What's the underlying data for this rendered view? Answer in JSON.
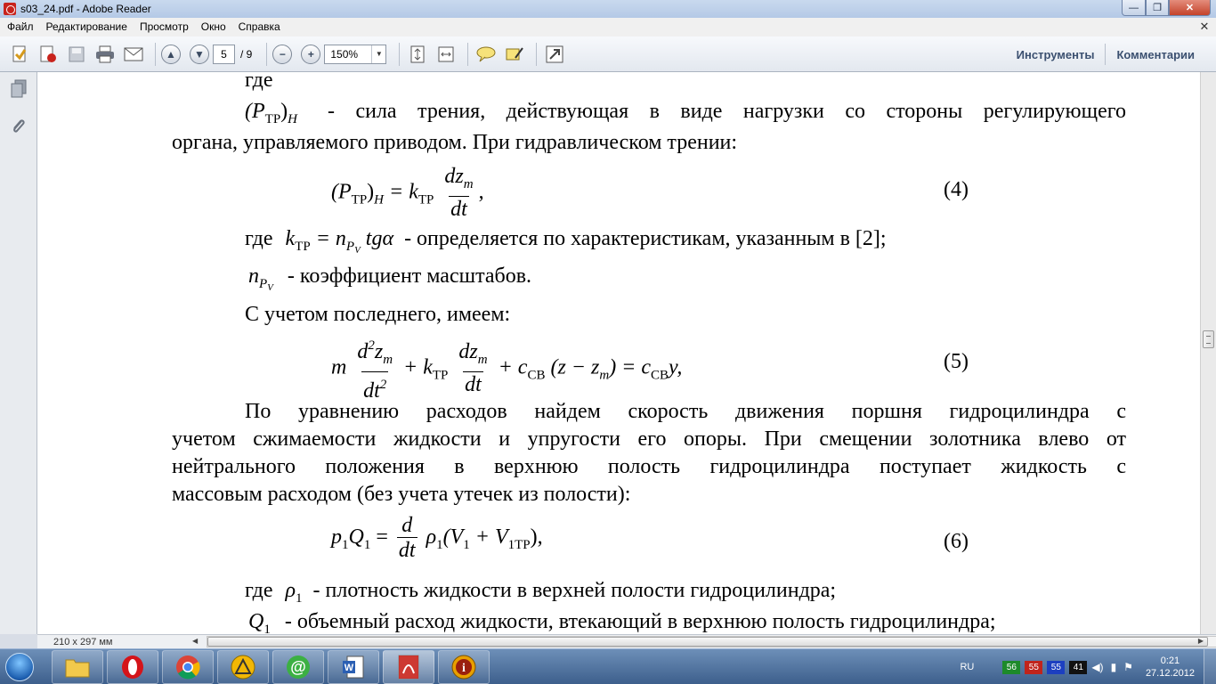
{
  "window": {
    "title": "s03_24.pdf - Adobe Reader",
    "minimize_glyph": "—",
    "maximize_glyph": "❐",
    "close_glyph": "✕"
  },
  "menu": {
    "items": [
      "Файл",
      "Редактирование",
      "Просмотр",
      "Окно",
      "Справка"
    ],
    "close_glyph": "✕"
  },
  "toolbar": {
    "current_page": "5",
    "total_pages": "/ 9",
    "zoom": "150%",
    "tools_label": "Инструменты",
    "comments_label": "Комментарии",
    "prev_glyph": "▲",
    "next_glyph": "▼",
    "zoom_out_glyph": "−",
    "zoom_in_glyph": "+",
    "dropdown_glyph": "▼"
  },
  "status": {
    "page_size": "210 x 297 мм"
  },
  "document": {
    "line01": "где",
    "l02_lhs_base": "(P",
    "l02_lhs_sub": "ТР",
    "l02_lhs_close": ")",
    "l02_lhs_h": "H",
    "l02_text": "- сила трения, действующая в виде нагрузки со стороны регулирующего",
    "line03": "органа, управляемого приводом. При гидравлическом трении:",
    "eq4_lhs": "(P",
    "eq4_lhs_sub": "ТР",
    "eq4_lhs_close": ")",
    "eq4_lhs_h": "H",
    "eq4_eq": "= k",
    "eq4_k_sub": "ТР",
    "eq4_num": "dz",
    "eq4_num_sub": "m",
    "eq4_den": "dt",
    "eq4_tail": ",",
    "eq4_number": "(4)",
    "l05_where": "где",
    "l05_k": "k",
    "l05_k_sub": "ТР",
    "l05_eq": "= n",
    "l05_n_sub": "P",
    "l05_n_subsub": "V",
    "l05_tg": "tgα",
    "l05_text": "- определяется по характеристикам, указанным в [2];",
    "l06_n": "n",
    "l06_n_sub": "P",
    "l06_n_subsub": "V",
    "l06_text": "- коэффициент масштабов.",
    "line07": "С учетом последнего, имеем:",
    "eq5_m": "m",
    "eq5_num1": "d",
    "eq5_num1_sup": "2",
    "eq5_num1_z": "z",
    "eq5_num1_sub": "m",
    "eq5_den1": "dt",
    "eq5_den1_sup": "2",
    "eq5_plus_k": "+ k",
    "eq5_k_sub": "ТР",
    "eq5_num2": "dz",
    "eq5_num2_sub": "m",
    "eq5_den2": "dt",
    "eq5_plus_c": "+ c",
    "eq5_c_sub": "СВ",
    "eq5_paren": "(z − z",
    "eq5_paren_sub": "m",
    "eq5_paren_close": ") = c",
    "eq5_c2_sub": "СВ",
    "eq5_tail": "y,",
    "eq5_number": "(5)",
    "para1_line1": "По уравнению расходов найдем скорость движения поршня гидроцилиндра с",
    "para1_line2": "учетом сжимаемости жидкости и упругости его опоры. При смещении золотника влево от",
    "para1_line3": "нейтрального положения в верхнюю полость гидроцилиндра поступает жидкость с",
    "para1_line4": "массовым расходом (без учета утечек из полости):",
    "eq6_lhs": "p",
    "eq6_p_sub": "1",
    "eq6_q": "Q",
    "eq6_q_sub": "1",
    "eq6_eq": "=",
    "eq6_num": "d",
    "eq6_den": "dt",
    "eq6_rho": "ρ",
    "eq6_rho_sub": "1",
    "eq6_paren": "(V",
    "eq6_v_sub": "1",
    "eq6_plus": "+ V",
    "eq6_v2_sub": "1ТР",
    "eq6_tail": "),",
    "eq6_number": "(6)",
    "l12_where": "где",
    "l12_rho": "ρ",
    "l12_rho_sub": "1",
    "l12_text": "- плотность жидкости в верхней полости гидроцилиндра;",
    "l13_q": "Q",
    "l13_q_sub": "1",
    "l13_text": "- объемный расход жидкости, втекающий в верхнюю полость гидроцилиндра;"
  },
  "taskbar": {
    "lang": "RU",
    "tray_numbers": [
      "56",
      "55",
      "55",
      "41"
    ],
    "tray_colors": [
      "#1d8a2a",
      "#c0241c",
      "#1c3fc0",
      "#111111"
    ],
    "time": "0:21",
    "date": "27.12.2012"
  }
}
